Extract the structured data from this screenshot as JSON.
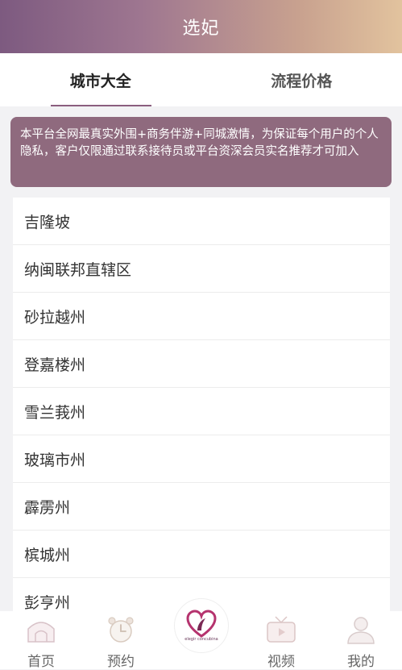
{
  "header": {
    "title": "选妃"
  },
  "tabs": [
    {
      "label": "城市大全",
      "active": true
    },
    {
      "label": "流程价格",
      "active": false
    }
  ],
  "notice": {
    "text": "本平台全网最真实外围+商务伴游+同城激情，为保证每个用户的个人隐私，客户仅限通过联系接待员或平台资深会员实名推荐才可加入"
  },
  "cities": [
    "吉隆坡",
    "纳闽联邦直辖区",
    "砂拉越州",
    "登嘉楼州",
    "雪兰莪州",
    "玻璃市州",
    "霹雳州",
    "槟城州",
    "彭亨州"
  ],
  "tabbar": {
    "items": [
      {
        "label": "首页",
        "icon": "home-icon"
      },
      {
        "label": "预约",
        "icon": "alarm-clock-icon"
      },
      {
        "label": "视频",
        "icon": "tv-icon"
      },
      {
        "label": "我的",
        "icon": "user-icon"
      }
    ],
    "center_logo_text": "elegir concubina"
  },
  "colors": {
    "header_gradient_start": "#7d5a80",
    "header_gradient_end": "#e2c39e",
    "notice_bg": "#8f6a7e",
    "tab_underline": "#8b5e7e"
  }
}
